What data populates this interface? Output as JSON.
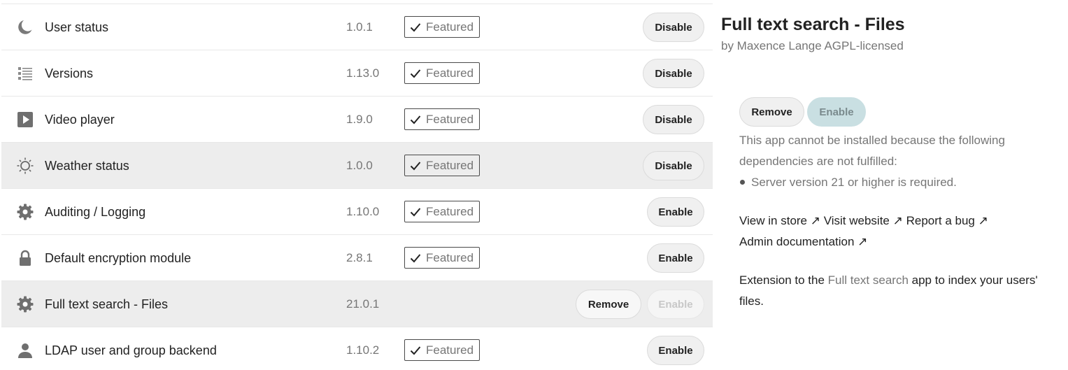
{
  "apps": [
    {
      "name": "User status",
      "version": "1.0.1",
      "featured_label": "Featured",
      "icon": "moon-icon",
      "action_label": "Disable",
      "highlighted": false
    },
    {
      "name": "Versions",
      "version": "1.13.0",
      "featured_label": "Featured",
      "icon": "list-icon",
      "action_label": "Disable",
      "highlighted": false
    },
    {
      "name": "Video player",
      "version": "1.9.0",
      "featured_label": "Featured",
      "icon": "play-icon",
      "action_label": "Disable",
      "highlighted": false
    },
    {
      "name": "Weather status",
      "version": "1.0.0",
      "featured_label": "Featured",
      "icon": "sun-icon",
      "action_label": "Disable",
      "highlighted": true
    },
    {
      "name": "Auditing / Logging",
      "version": "1.10.0",
      "featured_label": "Featured",
      "icon": "gear-icon",
      "action_label": "Enable",
      "highlighted": false
    },
    {
      "name": "Default encryption module",
      "version": "2.8.1",
      "featured_label": "Featured",
      "icon": "lock-icon",
      "action_label": "Enable",
      "highlighted": false
    },
    {
      "name": "Full text search - Files",
      "version": "21.0.1",
      "featured_label": "",
      "icon": "gear-icon",
      "remove_label": "Remove",
      "action_label": "Enable",
      "action_disabled": true,
      "highlighted": true
    },
    {
      "name": "LDAP user and group backend",
      "version": "1.10.2",
      "featured_label": "Featured",
      "icon": "user-icon",
      "action_label": "Enable",
      "highlighted": false
    }
  ],
  "details": {
    "title": "Full text search - Files",
    "author": "by Maxence Lange AGPL-licensed",
    "remove_label": "Remove",
    "enable_label": "Enable",
    "dependency_message": "This app cannot be installed because the following dependencies are not fulfilled:",
    "dependencies": [
      "Server version 21 or higher is required."
    ],
    "links": {
      "store": "View in store ↗",
      "website": "Visit website ↗",
      "bug": "Report a bug ↗",
      "admin_docs": "Admin documentation ↗"
    },
    "description": {
      "prefix": "Extension to the ",
      "link": "Full text search",
      "suffix": " app to index your users' files."
    }
  }
}
